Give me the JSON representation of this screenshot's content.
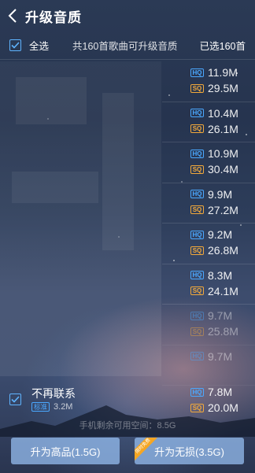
{
  "header": {
    "title": "升级音质"
  },
  "select_bar": {
    "select_all_label": "全选",
    "count_label": "共160首歌曲可升级音质",
    "selected_label": "已选160首"
  },
  "badges": {
    "hq": "HQ",
    "sq": "SQ",
    "standard": "标准"
  },
  "rows": [
    {
      "hq": "11.9M",
      "sq": "29.5M"
    },
    {
      "hq": "10.4M",
      "sq": "26.1M"
    },
    {
      "hq": "10.9M",
      "sq": "30.4M"
    },
    {
      "hq": "9.9M",
      "sq": "27.2M"
    },
    {
      "hq": "9.2M",
      "sq": "26.8M"
    },
    {
      "hq": "8.3M",
      "sq": "24.1M"
    },
    {
      "hq": "9.7M",
      "sq": "25.8M"
    },
    {
      "hq": "9.7M",
      "sq": ""
    }
  ],
  "song": {
    "title": "不再联系",
    "standard_size": "3.2M",
    "hq": "7.8M",
    "sq": "20.0M"
  },
  "storage_text": "手机剩余可用空间：8.5G",
  "buttons": {
    "upgrade_hq": "升为高品(1.5G)",
    "upgrade_sq": "升为无损(3.5G)",
    "ribbon": "限时免费"
  },
  "colors": {
    "hq": "#4aa8ff",
    "sq": "#f2a93b",
    "button": "#96bef0",
    "ribbon": "#f5a623"
  }
}
